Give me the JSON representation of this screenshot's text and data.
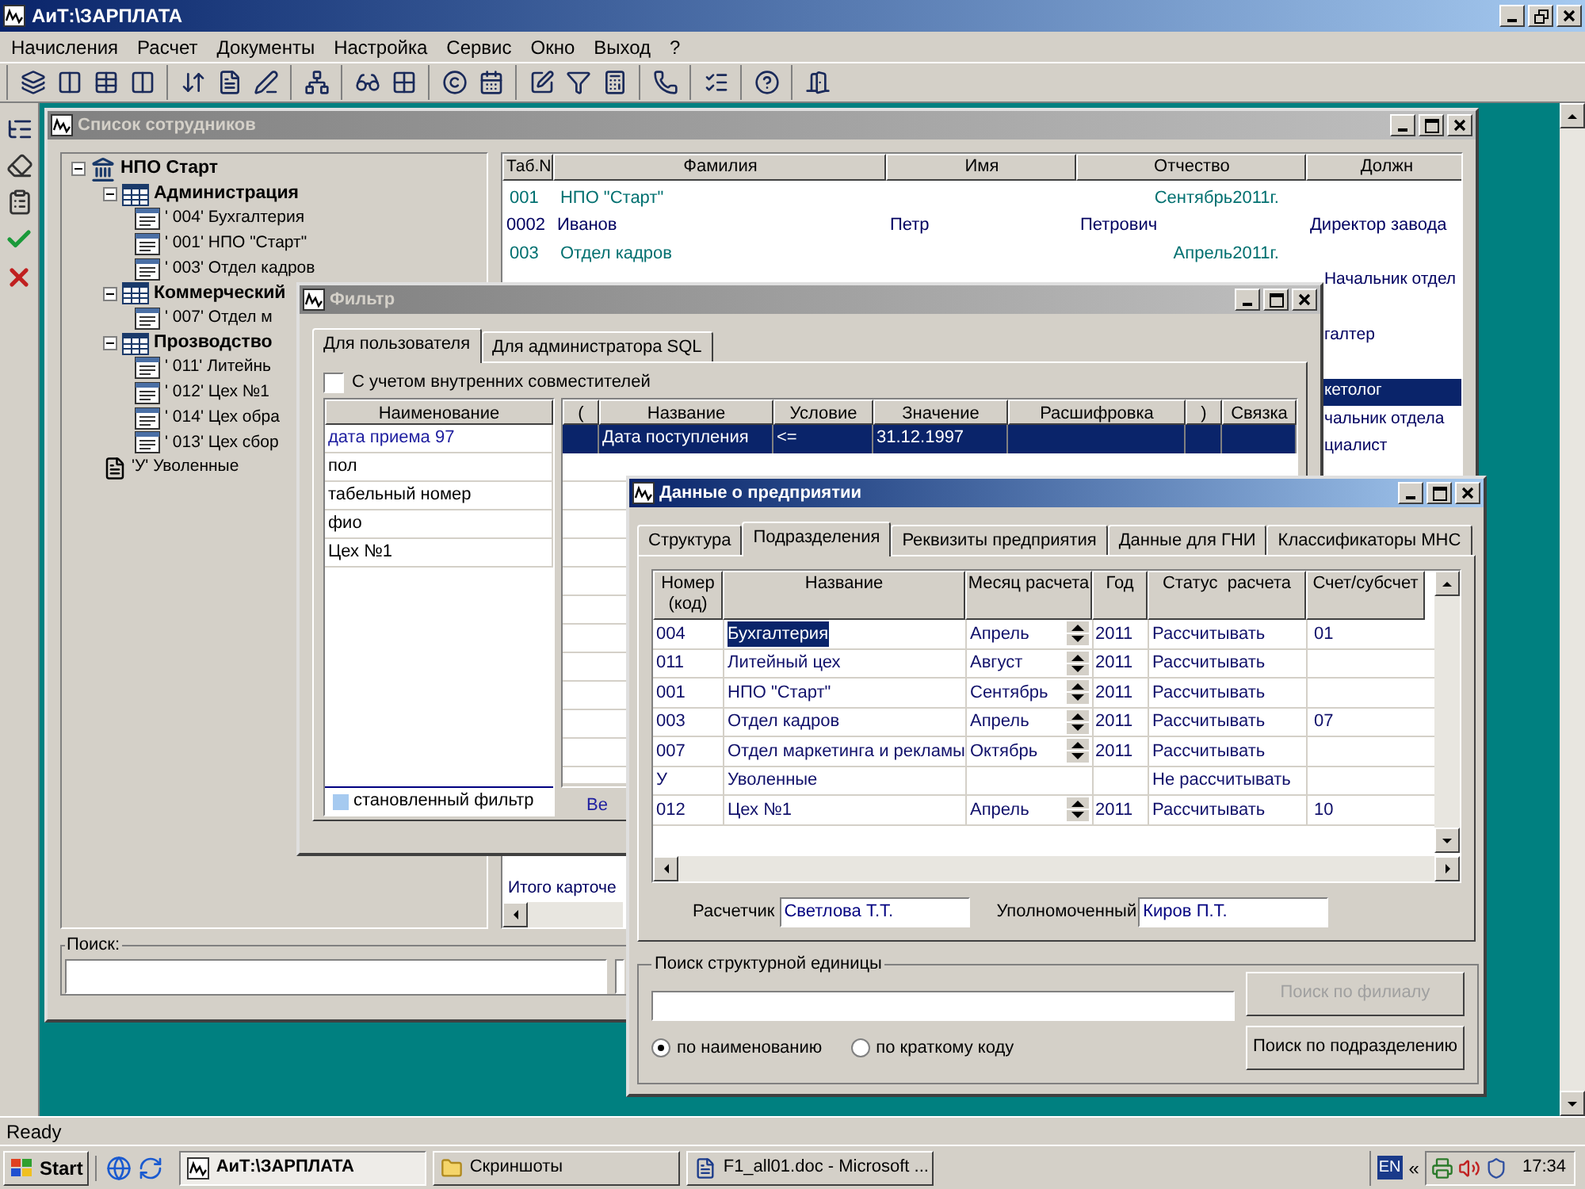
{
  "window": {
    "title": "АиТ:\\ЗАРПЛАТА"
  },
  "menu": [
    "Начисления",
    "Расчет",
    "Документы",
    "Настройка",
    "Сервис",
    "Окно",
    "Выход",
    "?"
  ],
  "employees": {
    "title": "Список сотрудников",
    "active": false,
    "tree": [
      {
        "label": "НПО Старт",
        "kind": "org",
        "expanded": true,
        "children": [
          {
            "label": "Администрация",
            "kind": "division",
            "expanded": true,
            "children": [
              {
                "label": "' 004' Бухгалтерия",
                "kind": "unit"
              },
              {
                "label": "' 001' НПО \"Старт\"",
                "kind": "unit"
              },
              {
                "label": "' 003' Отдел кадров",
                "kind": "unit"
              }
            ]
          },
          {
            "label": "Коммерческий",
            "kind": "division",
            "expanded": true,
            "children": [
              {
                "label": "' 007' Отдел м",
                "kind": "unit"
              }
            ]
          },
          {
            "label": "Прозводство",
            "kind": "division",
            "expanded": true,
            "children": [
              {
                "label": "' 011' Литейнь",
                "kind": "unit"
              },
              {
                "label": "' 012' Цех №1",
                "kind": "unit"
              },
              {
                "label": "' 014' Цех обра",
                "kind": "unit"
              },
              {
                "label": "' 013' Цех сбор",
                "kind": "unit"
              }
            ]
          },
          {
            "label": "'У' Уволенные",
            "kind": "fired"
          }
        ]
      }
    ],
    "list": {
      "columns": [
        "Таб.N",
        "Фамилия",
        "Имя",
        "Отчество",
        "Должн"
      ],
      "rows": [
        {
          "kind": "group",
          "code": "001",
          "name": "НПО \"Старт\"",
          "period": "Сентябрь2011г.",
          "selected": false
        },
        {
          "kind": "person",
          "cells": [
            "0002",
            "Иванов",
            "Петр",
            "Петрович",
            "Директор завода"
          ],
          "selected": false
        },
        {
          "kind": "group",
          "code": "003",
          "name": "Отдел кадров",
          "period": "Апрель2011г.",
          "selected": false
        },
        {
          "kind": "covered",
          "position": "Начальник отдел",
          "selected": false
        },
        {
          "kind": "hidden",
          "selected": false
        },
        {
          "kind": "covered",
          "position": "галтер",
          "selected": false
        },
        {
          "kind": "hidden",
          "selected": false
        },
        {
          "kind": "covered",
          "position": "кетолог",
          "selected": true
        },
        {
          "kind": "covered",
          "position": "чальник отдела",
          "selected": false
        },
        {
          "kind": "covered",
          "position": "циалист",
          "selected": false
        }
      ],
      "totals": [
        "Итого карточе"
      ]
    },
    "search": {
      "label": "Поиск:"
    }
  },
  "filter": {
    "title": "Фильтр",
    "active": false,
    "tabs": [
      {
        "label": "Для пользователя",
        "selected": true
      },
      {
        "label": "Для администратора SQL",
        "selected": false
      }
    ],
    "inner_staff": {
      "label": "С учетом внутренних совместителей",
      "checked": false
    },
    "saved": {
      "column": "Наименование",
      "items": [
        {
          "label": "дата приема 97",
          "applied": true
        },
        {
          "label": "пол",
          "applied": false
        },
        {
          "label": "табельный номер",
          "applied": false
        },
        {
          "label": "фио",
          "applied": false
        },
        {
          "label": "Цех №1",
          "applied": false
        }
      ]
    },
    "legend": "становленный фильтр",
    "conditions": {
      "columns": [
        "(",
        "Название",
        "Условие",
        "Значение",
        "Расшифровка",
        ")",
        "Связка"
      ],
      "rows": [
        {
          "name": "Дата поступления",
          "condition": "<=",
          "value": "31.12.1997",
          "selected": true
        }
      ]
    },
    "partial_button": "Ве"
  },
  "enterprise": {
    "title": "Данные о предприятии",
    "active": true,
    "tabs": [
      {
        "label": "Структура",
        "selected": false
      },
      {
        "label": "Подразделения",
        "selected": true
      },
      {
        "label": "Реквизиты предприятия",
        "selected": false
      },
      {
        "label": "Данные для ГНИ",
        "selected": false
      },
      {
        "label": "Классификаторы МНС",
        "selected": false
      }
    ],
    "columns": [
      "Номер\n(код)",
      "Название",
      "Месяц расчета",
      "Год",
      "Статус  расчета",
      "Счет/субсчет"
    ],
    "rows": [
      {
        "code": "004",
        "name": "Бухгалтерия",
        "month": "Апрель",
        "year": "2011",
        "status": "Рассчитывать",
        "account": "01",
        "selected": true
      },
      {
        "code": "011",
        "name": "Литейный цех",
        "month": "Август",
        "year": "2011",
        "status": "Рассчитывать",
        "selected": false
      },
      {
        "code": "001",
        "name": "НПО \"Старт\"",
        "month": "Сентябрь",
        "year": "2011",
        "status": "Рассчитывать",
        "selected": false
      },
      {
        "code": "003",
        "name": "Отдел кадров",
        "month": "Апрель",
        "year": "2011",
        "status": "Рассчитывать",
        "account": "07",
        "selected": false
      },
      {
        "code": "007",
        "name": "Отдел маркетинга и рекламы",
        "month": "Октябрь",
        "year": "2011",
        "status": "Рассчитывать",
        "selected": false
      },
      {
        "code": "У",
        "name": "Уволенные",
        "status": "Не рассчитывать",
        "selected": false
      },
      {
        "code": "012",
        "name": "Цех №1",
        "month": "Апрель",
        "year": "2011",
        "status": "Рассчитывать",
        "account": "10",
        "selected": false
      }
    ],
    "calculator": {
      "label": "Расчетчик",
      "value": "Светлова Т.Т."
    },
    "authorized": {
      "label": "Уполномоченный",
      "value": "Киров П.Т."
    },
    "search": {
      "title": "Поиск структурной единицы",
      "modes": [
        {
          "label": "по наименованию",
          "selected": true
        },
        {
          "label": "по краткому коду",
          "selected": false
        }
      ],
      "buttons": [
        {
          "label": "Поиск по филиалу",
          "disabled": true
        },
        {
          "label": "Поиск по подразделению",
          "disabled": false
        }
      ]
    }
  },
  "status": "Ready",
  "taskbar": {
    "start": "Start",
    "tasks": [
      {
        "label": "АиТ:\\ЗАРПЛАТА",
        "kind": "app",
        "selected": true
      },
      {
        "label": "Скриншоты",
        "kind": "folder",
        "selected": false
      },
      {
        "label": "F1_all01.doc - Microsoft ...",
        "kind": "document",
        "selected": false
      }
    ],
    "language": "EN",
    "chevron": "«",
    "clock": "17:34"
  }
}
